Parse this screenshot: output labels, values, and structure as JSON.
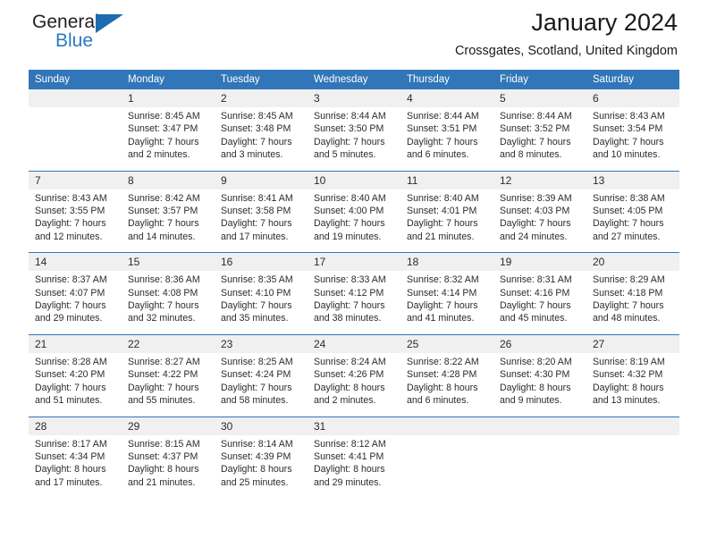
{
  "logo": {
    "word_top": "General",
    "word_bottom": "Blue",
    "triangle_color": "#1d6cb0",
    "blue_text_color": "#2a7ac0"
  },
  "header": {
    "title": "January 2024",
    "location": "Crossgates, Scotland, United Kingdom",
    "header_bg_color": "#3176b8",
    "daynum_bg_color": "#f0f0f0"
  },
  "weekday_headers": [
    "Sunday",
    "Monday",
    "Tuesday",
    "Wednesday",
    "Thursday",
    "Friday",
    "Saturday"
  ],
  "weeks": [
    [
      {
        "day": "",
        "lines": []
      },
      {
        "day": "1",
        "lines": [
          "Sunrise: 8:45 AM",
          "Sunset: 3:47 PM",
          "Daylight: 7 hours",
          "and 2 minutes."
        ]
      },
      {
        "day": "2",
        "lines": [
          "Sunrise: 8:45 AM",
          "Sunset: 3:48 PM",
          "Daylight: 7 hours",
          "and 3 minutes."
        ]
      },
      {
        "day": "3",
        "lines": [
          "Sunrise: 8:44 AM",
          "Sunset: 3:50 PM",
          "Daylight: 7 hours",
          "and 5 minutes."
        ]
      },
      {
        "day": "4",
        "lines": [
          "Sunrise: 8:44 AM",
          "Sunset: 3:51 PM",
          "Daylight: 7 hours",
          "and 6 minutes."
        ]
      },
      {
        "day": "5",
        "lines": [
          "Sunrise: 8:44 AM",
          "Sunset: 3:52 PM",
          "Daylight: 7 hours",
          "and 8 minutes."
        ]
      },
      {
        "day": "6",
        "lines": [
          "Sunrise: 8:43 AM",
          "Sunset: 3:54 PM",
          "Daylight: 7 hours",
          "and 10 minutes."
        ]
      }
    ],
    [
      {
        "day": "7",
        "lines": [
          "Sunrise: 8:43 AM",
          "Sunset: 3:55 PM",
          "Daylight: 7 hours",
          "and 12 minutes."
        ]
      },
      {
        "day": "8",
        "lines": [
          "Sunrise: 8:42 AM",
          "Sunset: 3:57 PM",
          "Daylight: 7 hours",
          "and 14 minutes."
        ]
      },
      {
        "day": "9",
        "lines": [
          "Sunrise: 8:41 AM",
          "Sunset: 3:58 PM",
          "Daylight: 7 hours",
          "and 17 minutes."
        ]
      },
      {
        "day": "10",
        "lines": [
          "Sunrise: 8:40 AM",
          "Sunset: 4:00 PM",
          "Daylight: 7 hours",
          "and 19 minutes."
        ]
      },
      {
        "day": "11",
        "lines": [
          "Sunrise: 8:40 AM",
          "Sunset: 4:01 PM",
          "Daylight: 7 hours",
          "and 21 minutes."
        ]
      },
      {
        "day": "12",
        "lines": [
          "Sunrise: 8:39 AM",
          "Sunset: 4:03 PM",
          "Daylight: 7 hours",
          "and 24 minutes."
        ]
      },
      {
        "day": "13",
        "lines": [
          "Sunrise: 8:38 AM",
          "Sunset: 4:05 PM",
          "Daylight: 7 hours",
          "and 27 minutes."
        ]
      }
    ],
    [
      {
        "day": "14",
        "lines": [
          "Sunrise: 8:37 AM",
          "Sunset: 4:07 PM",
          "Daylight: 7 hours",
          "and 29 minutes."
        ]
      },
      {
        "day": "15",
        "lines": [
          "Sunrise: 8:36 AM",
          "Sunset: 4:08 PM",
          "Daylight: 7 hours",
          "and 32 minutes."
        ]
      },
      {
        "day": "16",
        "lines": [
          "Sunrise: 8:35 AM",
          "Sunset: 4:10 PM",
          "Daylight: 7 hours",
          "and 35 minutes."
        ]
      },
      {
        "day": "17",
        "lines": [
          "Sunrise: 8:33 AM",
          "Sunset: 4:12 PM",
          "Daylight: 7 hours",
          "and 38 minutes."
        ]
      },
      {
        "day": "18",
        "lines": [
          "Sunrise: 8:32 AM",
          "Sunset: 4:14 PM",
          "Daylight: 7 hours",
          "and 41 minutes."
        ]
      },
      {
        "day": "19",
        "lines": [
          "Sunrise: 8:31 AM",
          "Sunset: 4:16 PM",
          "Daylight: 7 hours",
          "and 45 minutes."
        ]
      },
      {
        "day": "20",
        "lines": [
          "Sunrise: 8:29 AM",
          "Sunset: 4:18 PM",
          "Daylight: 7 hours",
          "and 48 minutes."
        ]
      }
    ],
    [
      {
        "day": "21",
        "lines": [
          "Sunrise: 8:28 AM",
          "Sunset: 4:20 PM",
          "Daylight: 7 hours",
          "and 51 minutes."
        ]
      },
      {
        "day": "22",
        "lines": [
          "Sunrise: 8:27 AM",
          "Sunset: 4:22 PM",
          "Daylight: 7 hours",
          "and 55 minutes."
        ]
      },
      {
        "day": "23",
        "lines": [
          "Sunrise: 8:25 AM",
          "Sunset: 4:24 PM",
          "Daylight: 7 hours",
          "and 58 minutes."
        ]
      },
      {
        "day": "24",
        "lines": [
          "Sunrise: 8:24 AM",
          "Sunset: 4:26 PM",
          "Daylight: 8 hours",
          "and 2 minutes."
        ]
      },
      {
        "day": "25",
        "lines": [
          "Sunrise: 8:22 AM",
          "Sunset: 4:28 PM",
          "Daylight: 8 hours",
          "and 6 minutes."
        ]
      },
      {
        "day": "26",
        "lines": [
          "Sunrise: 8:20 AM",
          "Sunset: 4:30 PM",
          "Daylight: 8 hours",
          "and 9 minutes."
        ]
      },
      {
        "day": "27",
        "lines": [
          "Sunrise: 8:19 AM",
          "Sunset: 4:32 PM",
          "Daylight: 8 hours",
          "and 13 minutes."
        ]
      }
    ],
    [
      {
        "day": "28",
        "lines": [
          "Sunrise: 8:17 AM",
          "Sunset: 4:34 PM",
          "Daylight: 8 hours",
          "and 17 minutes."
        ]
      },
      {
        "day": "29",
        "lines": [
          "Sunrise: 8:15 AM",
          "Sunset: 4:37 PM",
          "Daylight: 8 hours",
          "and 21 minutes."
        ]
      },
      {
        "day": "30",
        "lines": [
          "Sunrise: 8:14 AM",
          "Sunset: 4:39 PM",
          "Daylight: 8 hours",
          "and 25 minutes."
        ]
      },
      {
        "day": "31",
        "lines": [
          "Sunrise: 8:12 AM",
          "Sunset: 4:41 PM",
          "Daylight: 8 hours",
          "and 29 minutes."
        ]
      },
      {
        "day": "",
        "lines": []
      },
      {
        "day": "",
        "lines": []
      },
      {
        "day": "",
        "lines": []
      }
    ]
  ]
}
